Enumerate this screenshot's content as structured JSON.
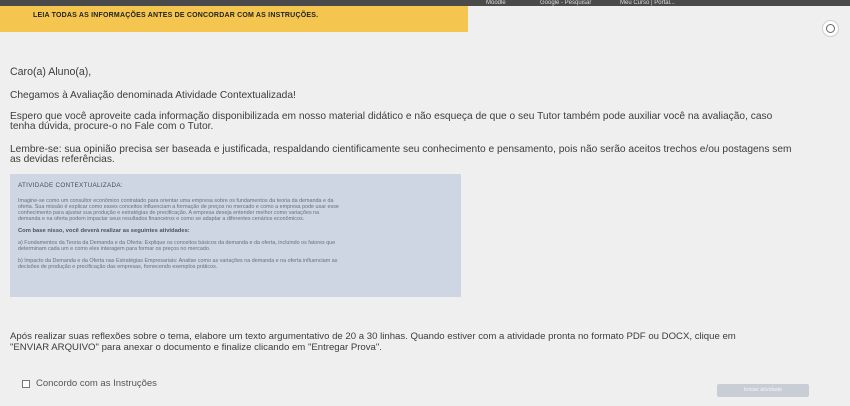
{
  "browser": {
    "bookmarks": [
      "Moodle",
      "Google - Pesquisar",
      "Meu Curso | Portal..."
    ]
  },
  "banner": {
    "text": "LEIA TODAS AS INFORMAÇÕES ANTES DE CONCORDAR COM AS INSTRUÇÕES."
  },
  "greeting": "Caro(a) Aluno(a),",
  "intro": "Chegamos à Avaliação denominada Atividade Contextualizada!",
  "hope_line1": "Espero que você aproveite cada informação disponibilizada em nosso material didático e não esqueça de que o seu Tutor também pode auxiliar você na avaliação, caso",
  "hope_line2": "tenha dúvida, procure-o no Fale com o Tutor.",
  "reminder_line1": "Lembre-se: sua opinião precisa ser baseada e justificada, respaldando cientificamente seu conhecimento e pensamento, pois não serão aceitos trechos e/ou postagens sem",
  "reminder_line2": "as devidas referências.",
  "activity": {
    "title": "ATIVIDADE CONTEXTUALIZADA:",
    "scenario": [
      "Imagine-se como um consultor econômico contratado para orientar uma empresa sobre os fundamentos da teoria da demanda e da",
      "oferta. Sua missão é explicar como esses conceitos influenciam a formação de preços no mercado e como a empresa pode usar esse",
      "conhecimento para ajustar sua produção e estratégias de precificação. A empresa deseja entender melhor como variações na",
      "demanda e na oferta podem impactar seus resultados financeiros e como se adaptar a diferentes cenários econômicos."
    ],
    "task_heading": "Com base nisso, você deverá realizar as seguintes atividades:",
    "item_a": [
      "a) Fundamentos da Teoria da Demanda e da Oferta: Explique os conceitos básicos da demanda e da oferta, incluindo os fatores que",
      "determinam cada um e como eles interagem para formar os preços no mercado."
    ],
    "item_b": [
      "b) Impacto da Demanda e da Oferta nas Estratégias Empresariais: Analise como as variações na demanda e na oferta influenciam as",
      "decisões de produção e precificação das empresas, fornecendo exemplos práticos."
    ]
  },
  "after_line1": "Após realizar suas reflexões sobre o tema, elabore um texto argumentativo de 20 a 30 linhas. Quando estiver com a atividade pronta no formato PDF ou DOCX, clique em",
  "after_line2": "\"ENVIAR ARQUIVO\" para anexar o documento e finalize clicando em \"Entregar Prova\".",
  "agree_label": "Concordo com as Instruções",
  "submit_label": "Iniciar atividade"
}
